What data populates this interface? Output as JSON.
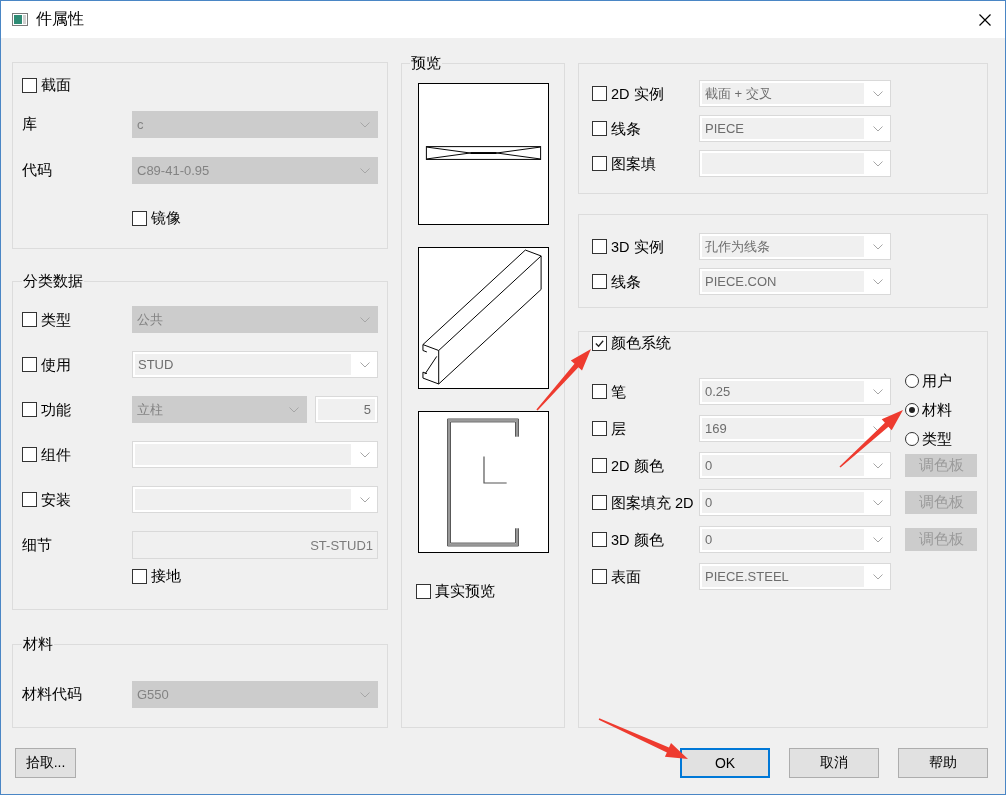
{
  "window": {
    "title": "件属性"
  },
  "section": {
    "checkbox": {
      "label": "截面",
      "checked": false
    },
    "fields": [
      {
        "label": "库",
        "kind": "list",
        "value": "c"
      },
      {
        "label": "代码",
        "kind": "list",
        "value": "C89-41-0.95"
      }
    ],
    "mirror": {
      "label": "镜像",
      "checked": false
    }
  },
  "classification": {
    "title": "分类数据",
    "rows": [
      {
        "label": "类型",
        "checked": false,
        "kind": "list",
        "value": "公共"
      },
      {
        "label": "使用",
        "checked": false,
        "kind": "edit",
        "value": "STUD"
      },
      {
        "label": "功能",
        "checked": false,
        "kind": "list",
        "value": "立柱",
        "number": "5"
      },
      {
        "label": "组件",
        "checked": false,
        "kind": "edit"
      },
      {
        "label": "安装",
        "checked": false,
        "kind": "edit"
      }
    ],
    "detail": {
      "label": "细节",
      "value": "ST-STUD1"
    },
    "grounding": {
      "label": "接地",
      "checked": false
    }
  },
  "material": {
    "title": "材料",
    "label": "材料代码",
    "kind": "list",
    "value": "G550"
  },
  "preview": {
    "title": "预览",
    "views": [
      {
        "kind": "section"
      },
      {
        "kind": "isometric"
      },
      {
        "kind": "profile"
      }
    ],
    "real_preview": {
      "label": "真实预览",
      "checked": false
    }
  },
  "instance_2d": [
    {
      "label": "2D 实例",
      "checked": false,
      "kind": "edit",
      "value": "截面 + 交叉"
    },
    {
      "label": "线条",
      "checked": false,
      "kind": "edit",
      "value": "PIECE"
    },
    {
      "label": "图案填",
      "checked": false,
      "kind": "edit"
    }
  ],
  "instance_3d": [
    {
      "label": "3D 实例",
      "checked": false,
      "kind": "edit",
      "value": "孔作为线条"
    },
    {
      "label": "线条",
      "checked": false,
      "kind": "edit",
      "value": "PIECE.CON"
    }
  ],
  "color_system": {
    "label": "颜色系统",
    "checked": true,
    "modes": [
      {
        "label": "用户",
        "selected": false
      },
      {
        "label": "材料",
        "selected": true
      },
      {
        "label": "类型",
        "selected": false
      }
    ],
    "rows": [
      {
        "label": "笔",
        "checked": false,
        "kind": "edit",
        "value": "0.25"
      },
      {
        "label": "层",
        "checked": false,
        "kind": "edit",
        "value": "169"
      },
      {
        "label": "2D 颜色",
        "checked": false,
        "kind": "edit",
        "value": "0",
        "palette": {
          "label": "调色板",
          "disabled": true
        }
      },
      {
        "label": "图案填充 2D",
        "checked": false,
        "kind": "edit",
        "value": "0",
        "palette": {
          "label": "调色板",
          "disabled": true
        }
      },
      {
        "label": "3D 颜色",
        "checked": false,
        "kind": "edit",
        "value": "0",
        "palette": {
          "label": "调色板",
          "disabled": true
        }
      },
      {
        "label": "表面",
        "checked": false,
        "kind": "edit",
        "value": "PIECE.STEEL"
      }
    ]
  },
  "pick_button": {
    "label": "拾取..."
  },
  "buttons": [
    {
      "label": "OK",
      "default": true
    },
    {
      "label": "取消",
      "default": false
    },
    {
      "label": "帮助",
      "default": false
    }
  ]
}
